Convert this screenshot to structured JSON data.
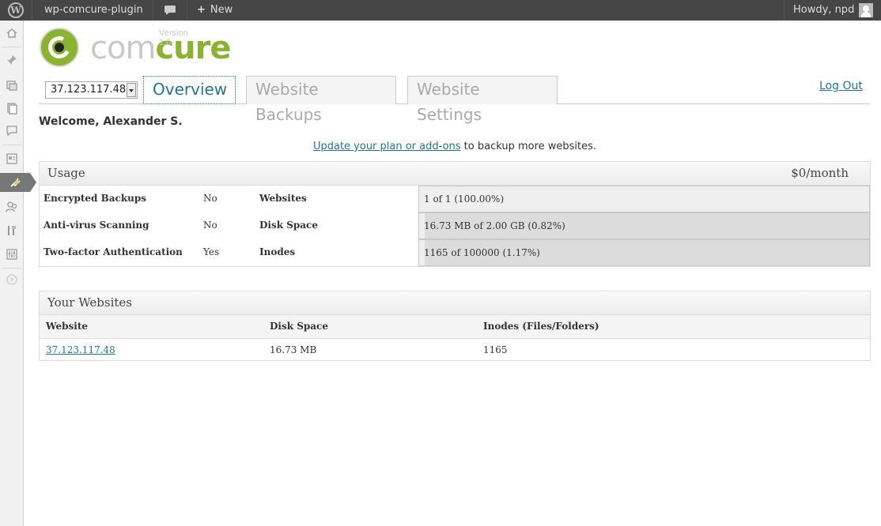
{
  "adminbar": {
    "site_name": "wp-comcure-plugin",
    "new_label": "New",
    "howdy": "Howdy, npd"
  },
  "logo": {
    "word_com": "com",
    "word_cure": "cure",
    "version": "Version 1.0"
  },
  "site_selector": {
    "value": "37.123.117.48"
  },
  "tabs": [
    {
      "label": "Overview",
      "active": true
    },
    {
      "label": "Website Backups",
      "active": false
    },
    {
      "label": "Website Settings",
      "active": false
    }
  ],
  "logout_label": "Log Out",
  "welcome": "Welcome, Alexander S.",
  "update": {
    "link": "Update your plan or add-ons",
    "rest": " to backup more websites."
  },
  "usage": {
    "title": "Usage",
    "price": "$0/month",
    "rows": [
      {
        "feature": "Encrypted Backups",
        "value": "No",
        "metric": "Websites",
        "meter_text": "1 of 1 (100.00%)",
        "percent": 100.0
      },
      {
        "feature": "Anti-virus Scanning",
        "value": "No",
        "metric": "Disk Space",
        "meter_text": "16.73 MB of 2.00 GB (0.82%)",
        "percent": 0.82
      },
      {
        "feature": "Two-factor Authentication",
        "value": "Yes",
        "metric": "Inodes",
        "meter_text": "1165 of 100000 (1.17%)",
        "percent": 1.17
      }
    ]
  },
  "websites": {
    "title": "Your Websites",
    "columns": [
      "Website",
      "Disk Space",
      "Inodes (Files/Folders)"
    ],
    "rows": [
      {
        "website": "37.123.117.48",
        "disk": "16.73 MB",
        "inodes": "1165"
      }
    ]
  },
  "colors": {
    "accent": "#21759b",
    "brand_green": "#8ab330",
    "adminbar": "#464646"
  }
}
